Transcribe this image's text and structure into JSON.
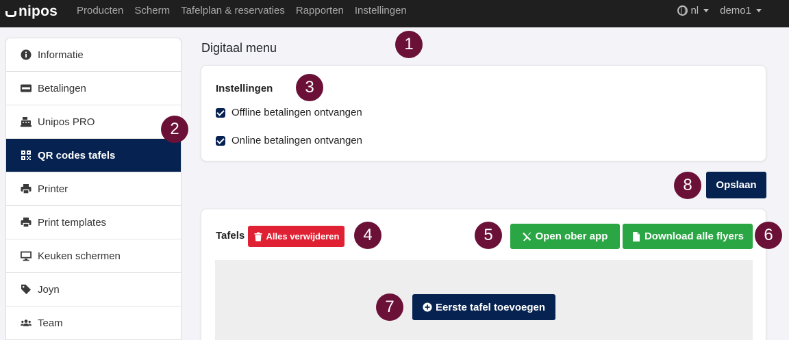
{
  "brand": {
    "name": "nipos"
  },
  "nav": {
    "items": [
      "Producten",
      "Scherm",
      "Tafelplan & reservaties",
      "Rapporten",
      "Instellingen"
    ],
    "language": "nl",
    "user": "demo1"
  },
  "sidebar": {
    "items": [
      {
        "label": "Informatie",
        "icon": "info-icon"
      },
      {
        "label": "Betalingen",
        "icon": "visa-card-icon"
      },
      {
        "label": "Unipos PRO",
        "icon": "cash-register-icon"
      },
      {
        "label": "QR codes tafels",
        "icon": "qr-code-icon",
        "active": true
      },
      {
        "label": "Printer",
        "icon": "printer-icon"
      },
      {
        "label": "Print templates",
        "icon": "printer-icon"
      },
      {
        "label": "Keuken schermen",
        "icon": "monitor-icon"
      },
      {
        "label": "Joyn",
        "icon": "tag-icon"
      },
      {
        "label": "Team",
        "icon": "users-icon"
      }
    ]
  },
  "main": {
    "title": "Digitaal menu",
    "settings": {
      "heading": "Instellingen",
      "offline": "Offline betalingen ontvangen",
      "online": "Online betalingen ontvangen"
    },
    "save_label": "Opslaan",
    "tables": {
      "heading": "Tafels",
      "delete_all": "Alles verwijderen",
      "open_waiter_app": "Open ober app",
      "download_flyers": "Download alle flyers",
      "add_first": "Eerste tafel toevoegen"
    }
  },
  "markers": [
    "1",
    "2",
    "3",
    "4",
    "5",
    "6",
    "7",
    "8"
  ],
  "colors": {
    "navy": "#062250",
    "green": "#2aa644",
    "red": "#e02133",
    "marker": "#6b1138",
    "topbar": "#1f1f1f"
  }
}
